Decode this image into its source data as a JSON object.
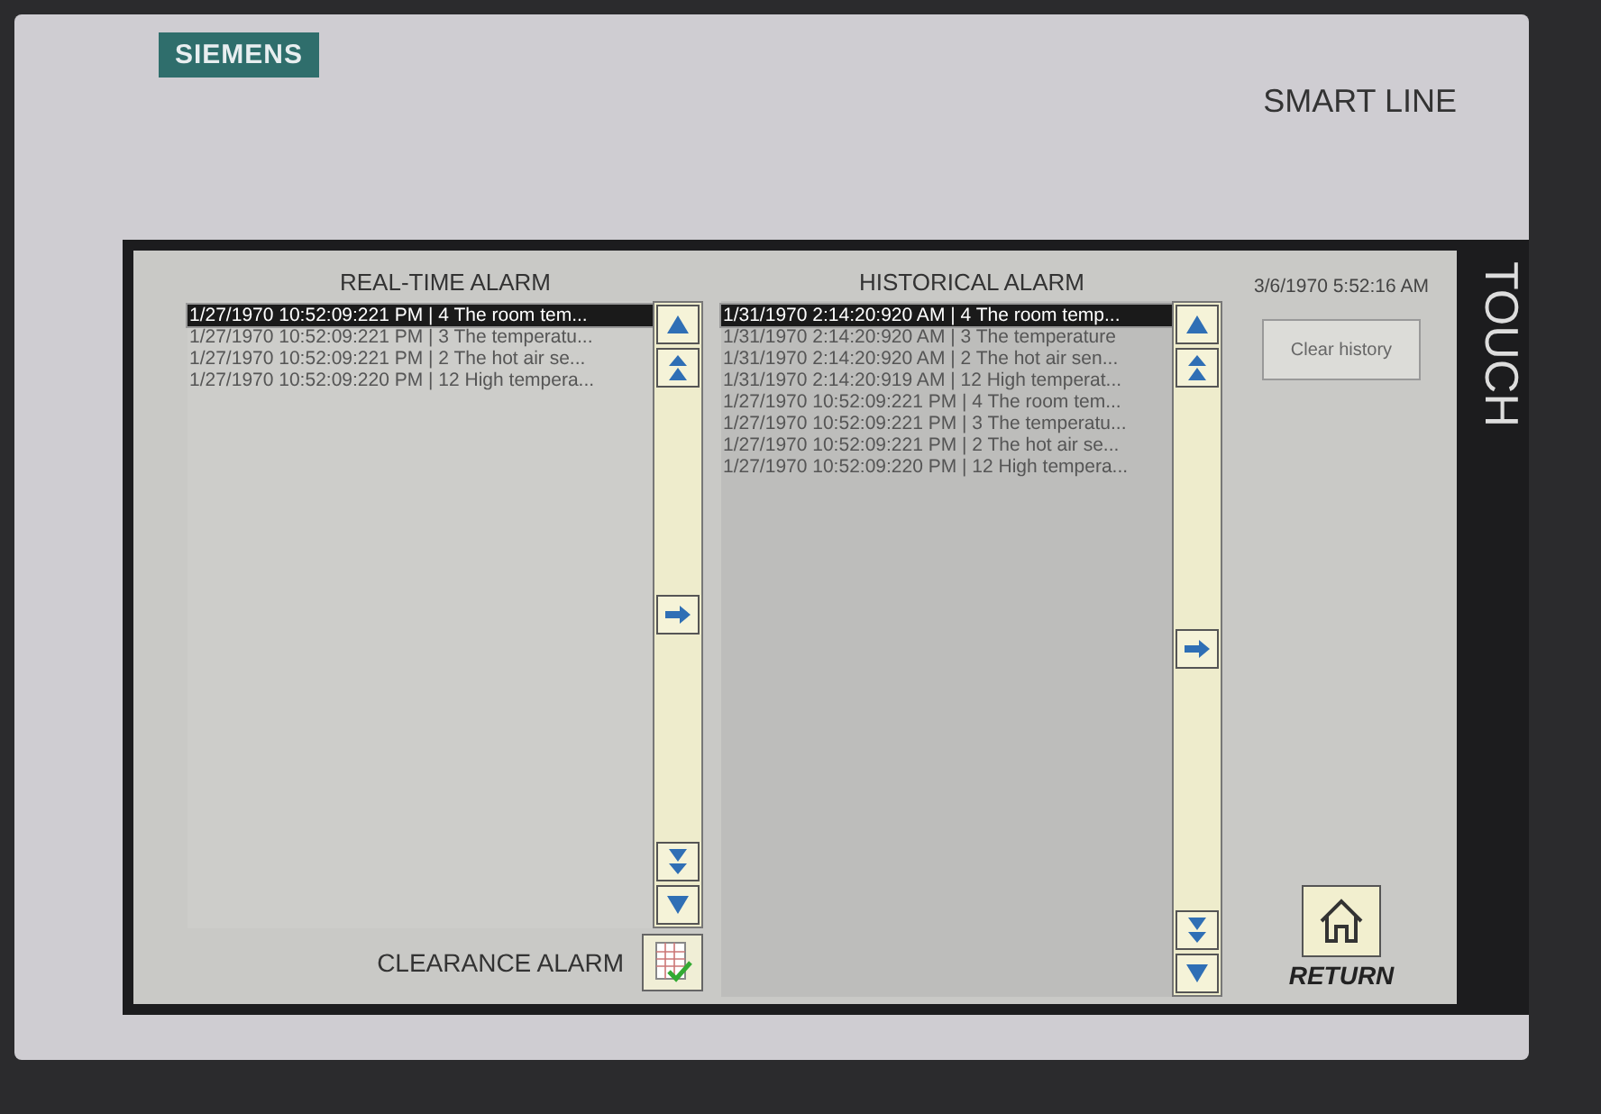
{
  "device": {
    "brand": "SIEMENS",
    "model": "SMART LINE",
    "side_label": "TOUCH"
  },
  "realtime": {
    "title": "REAL-TIME ALARM",
    "clear_label": "CLEARANCE ALARM",
    "rows": [
      {
        "text": "1/27/1970 10:52:09:221 PM | 4 The room tem...",
        "selected": true
      },
      {
        "text": "1/27/1970 10:52:09:221 PM | 3 The temperatu...",
        "selected": false
      },
      {
        "text": "1/27/1970 10:52:09:221 PM | 2 The hot air se...",
        "selected": false
      },
      {
        "text": "1/27/1970 10:52:09:220 PM | 12 High tempera...",
        "selected": false
      }
    ]
  },
  "historical": {
    "title": "HISTORICAL ALARM",
    "rows": [
      {
        "text": "1/31/1970 2:14:20:920 AM | 4 The room temp...",
        "selected": true
      },
      {
        "text": "1/31/1970 2:14:20:920 AM | 3 The temperature",
        "selected": false
      },
      {
        "text": "1/31/1970 2:14:20:920 AM | 2 The hot air sen...",
        "selected": false
      },
      {
        "text": "1/31/1970 2:14:20:919 AM | 12 High temperat...",
        "selected": false
      },
      {
        "text": "1/27/1970 10:52:09:221 PM | 4 The room tem...",
        "selected": false
      },
      {
        "text": "1/27/1970 10:52:09:221 PM | 3 The temperatu...",
        "selected": false
      },
      {
        "text": "1/27/1970 10:52:09:221 PM | 2 The hot air se...",
        "selected": false
      },
      {
        "text": "1/27/1970 10:52:09:220 PM | 12 High tempera...",
        "selected": false
      }
    ]
  },
  "clock": "3/6/1970 5:52:16 AM",
  "clear_history": "Clear history",
  "return_label": "RETURN"
}
